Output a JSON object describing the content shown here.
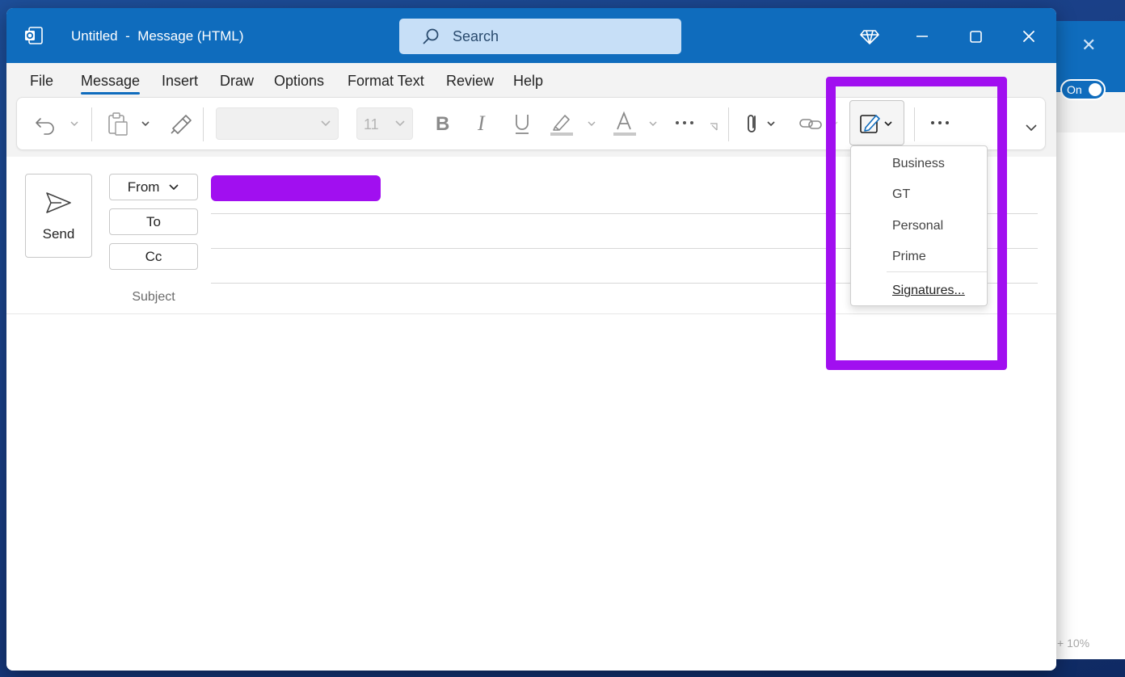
{
  "background_window": {
    "toggle_label": "On",
    "zoom_label": "10%"
  },
  "window": {
    "title": "Untitled  -  Message (HTML)",
    "search_label": "Search",
    "icons": [
      "outlook-icon",
      "premium-diamond-icon",
      "minimize-icon",
      "maximize-icon",
      "close-icon"
    ]
  },
  "menu": {
    "items": [
      "File",
      "Message",
      "Insert",
      "Draw",
      "Options",
      "Format Text",
      "Review",
      "Help"
    ],
    "active": "Message"
  },
  "ribbon": {
    "font_name": "",
    "font_size": "11",
    "icons": [
      "undo-icon",
      "paste-icon",
      "format-painter-icon",
      "bold-icon",
      "italic-icon",
      "underline-icon",
      "highlight-icon",
      "font-color-icon",
      "more-icon",
      "attach-icon",
      "link-icon",
      "signature-icon",
      "more-options-icon",
      "expand-ribbon-icon"
    ]
  },
  "compose": {
    "send_label": "Send",
    "from_label": "From",
    "to_label": "To",
    "cc_label": "Cc",
    "subject_label": "Subject",
    "from_value_redacted_color": "#a10ff0"
  },
  "signature_menu": {
    "items": [
      "Business",
      "GT",
      "Personal",
      "Prime"
    ],
    "manage_label": "Signatures..."
  },
  "colors": {
    "accent": "#0f6cbd",
    "highlight": "#a10ff0"
  }
}
